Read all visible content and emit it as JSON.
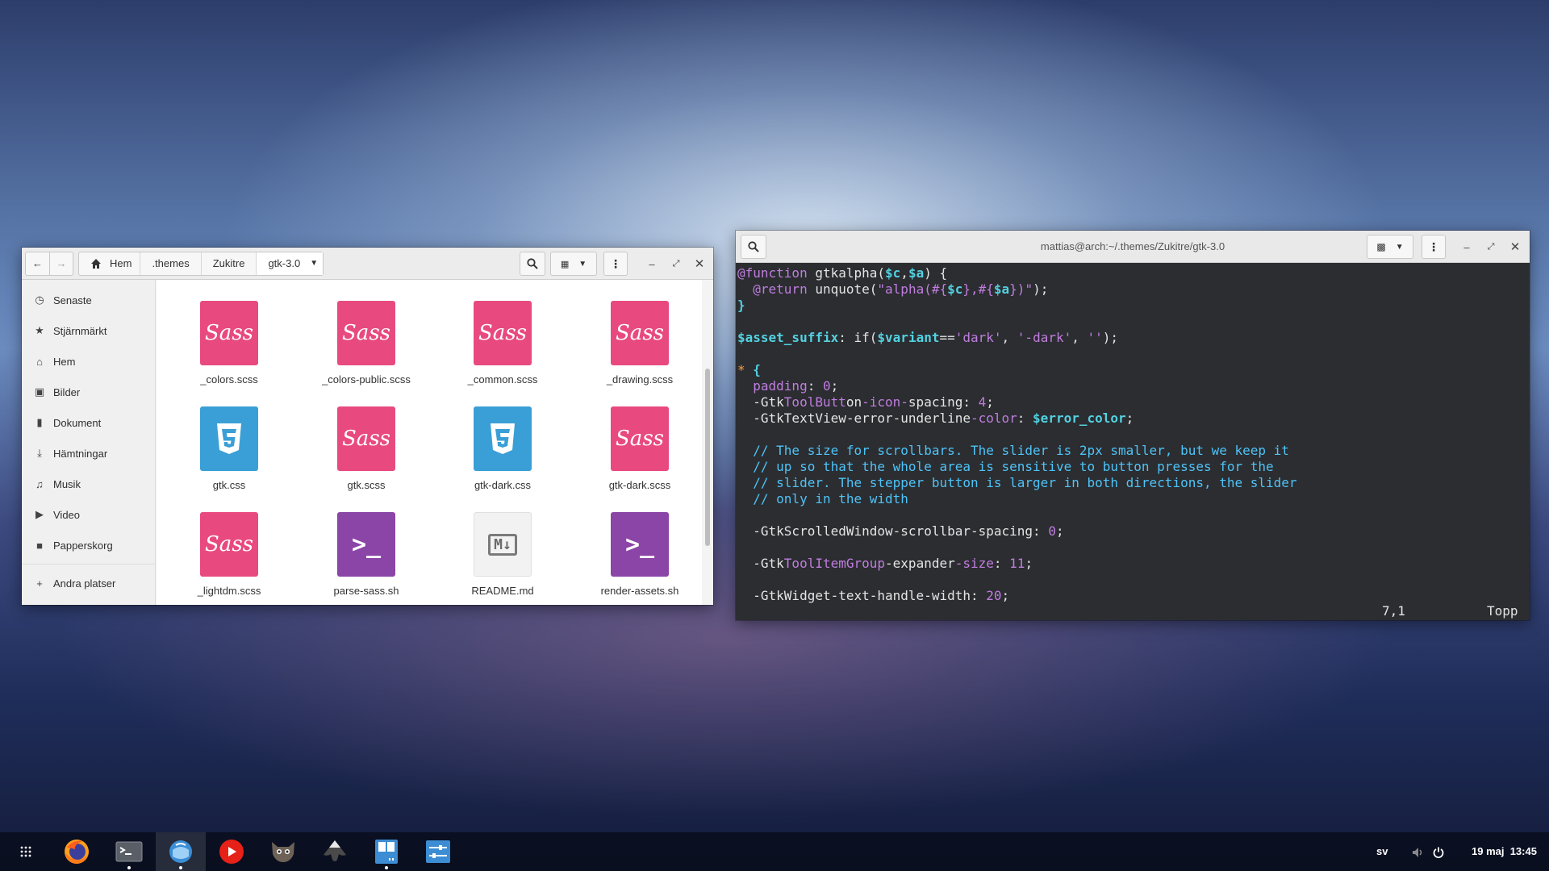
{
  "file_manager": {
    "breadcrumb": [
      "Hem",
      ".themes",
      "Zukitre",
      "gtk-3.0"
    ],
    "sidebar": [
      {
        "icon": "clock-icon",
        "label": "Senaste"
      },
      {
        "icon": "star-icon",
        "label": "Stjärnmärkt"
      },
      {
        "icon": "home-icon",
        "label": "Hem"
      },
      {
        "icon": "image-icon",
        "label": "Bilder"
      },
      {
        "icon": "document-icon",
        "label": "Dokument"
      },
      {
        "icon": "download-icon",
        "label": "Hämtningar"
      },
      {
        "icon": "music-icon",
        "label": "Musik"
      },
      {
        "icon": "video-icon",
        "label": "Video"
      },
      {
        "icon": "trash-icon",
        "label": "Papperskorg"
      },
      {
        "icon": "plus-icon",
        "label": "Andra platser"
      }
    ],
    "files": [
      {
        "name": "_colors.scss",
        "type": "sass"
      },
      {
        "name": "_colors-public.scss",
        "type": "sass"
      },
      {
        "name": "_common.scss",
        "type": "sass"
      },
      {
        "name": "_drawing.scss",
        "type": "sass"
      },
      {
        "name": "gtk.css",
        "type": "css"
      },
      {
        "name": "gtk.scss",
        "type": "sass"
      },
      {
        "name": "gtk-dark.css",
        "type": "css"
      },
      {
        "name": "gtk-dark.scss",
        "type": "sass"
      },
      {
        "name": "_lightdm.scss",
        "type": "sass"
      },
      {
        "name": "parse-sass.sh",
        "type": "shell"
      },
      {
        "name": "README.md",
        "type": "markdown"
      },
      {
        "name": "render-assets.sh",
        "type": "shell"
      }
    ],
    "icon_texts": {
      "sass": "Sass",
      "shell": ">_",
      "markdown": "M↓"
    }
  },
  "terminal": {
    "title": "mattias@arch:~/.themes/Zukitre/gtk-3.0",
    "status_position": "7,1",
    "status_scroll": "Topp"
  },
  "taskbar": {
    "language": "sv",
    "datetime": "19 maj  13:45",
    "apps": [
      {
        "name": "firefox",
        "running": false
      },
      {
        "name": "terminal",
        "running": true
      },
      {
        "name": "files",
        "running": true
      },
      {
        "name": "youtube",
        "running": false
      },
      {
        "name": "gimp",
        "running": false
      },
      {
        "name": "inkscape",
        "running": false
      },
      {
        "name": "text-editor",
        "running": true
      },
      {
        "name": "settings",
        "running": false
      }
    ]
  },
  "colors": {
    "sass": "#e84a7f",
    "css": "#3a9fd6",
    "shell": "#8a45a6",
    "terminal_bg": "#2b2d31"
  }
}
